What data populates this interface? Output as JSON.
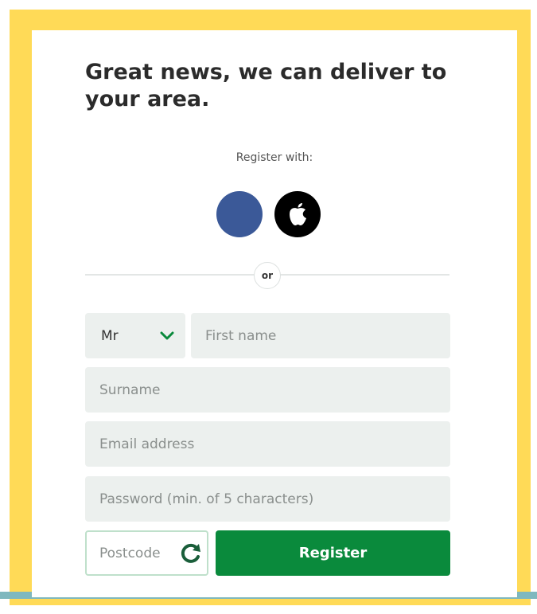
{
  "colors": {
    "frame": "#FFDA57",
    "accent_green": "#0A8A3C",
    "facebook": "#3B5998",
    "apple": "#000000",
    "field_bg": "#ECF0EE",
    "strip": "#7FB8BE"
  },
  "headline": "Great news, we can deliver to your area.",
  "register_with": "Register with:",
  "social": [
    {
      "name": "facebook",
      "icon": "facebook-icon"
    },
    {
      "name": "apple",
      "icon": "apple-icon"
    }
  ],
  "divider_text": "or",
  "form": {
    "title_value": "Mr",
    "first_name_placeholder": "First name",
    "surname_placeholder": "Surname",
    "email_placeholder": "Email address",
    "password_placeholder": "Password (min. of 5 characters)",
    "postcode_placeholder": "Postcode",
    "register_label": "Register"
  }
}
